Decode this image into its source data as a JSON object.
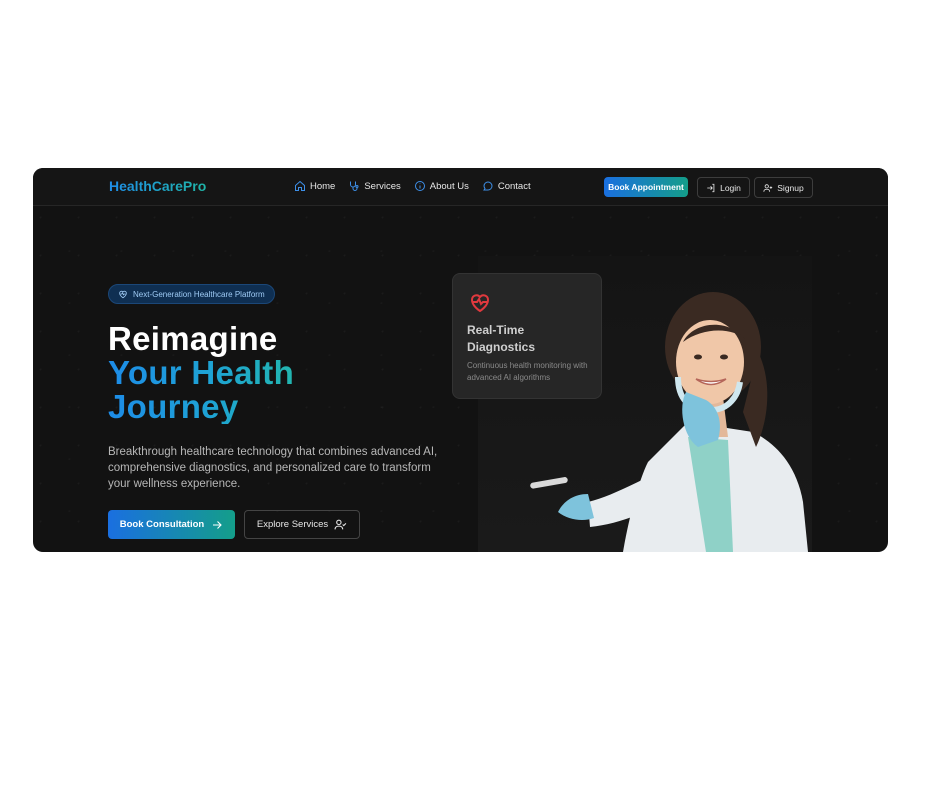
{
  "nav": {
    "brand": "HealthCarePro",
    "links": [
      {
        "label": "Home",
        "icon": "home-icon"
      },
      {
        "label": "Services",
        "icon": "stethoscope-icon"
      },
      {
        "label": "About Us",
        "icon": "info-icon"
      },
      {
        "label": "Contact",
        "icon": "chat-icon"
      }
    ],
    "book_label": "Book Appointment",
    "login_label": "Login",
    "signup_label": "Signup"
  },
  "hero": {
    "badge": "Next-Generation Healthcare Platform",
    "title_line1": "Reimagine",
    "title_line2": "Your Health",
    "title_line3": "Journey",
    "description": "Breakthrough healthcare technology that combines advanced AI, comprehensive diagnostics, and personalized care to transform your wellness experience.",
    "primary_cta": "Book Consultation",
    "secondary_cta": "Explore Services"
  },
  "card": {
    "title": "Real-Time Diagnostics",
    "subtitle": "Continuous health monitoring with advanced AI algorithms",
    "icon": "heart-pulse-icon"
  },
  "colors": {
    "accent_blue": "#1a6fe0",
    "accent_teal": "#149e8a",
    "background": "#121212"
  }
}
